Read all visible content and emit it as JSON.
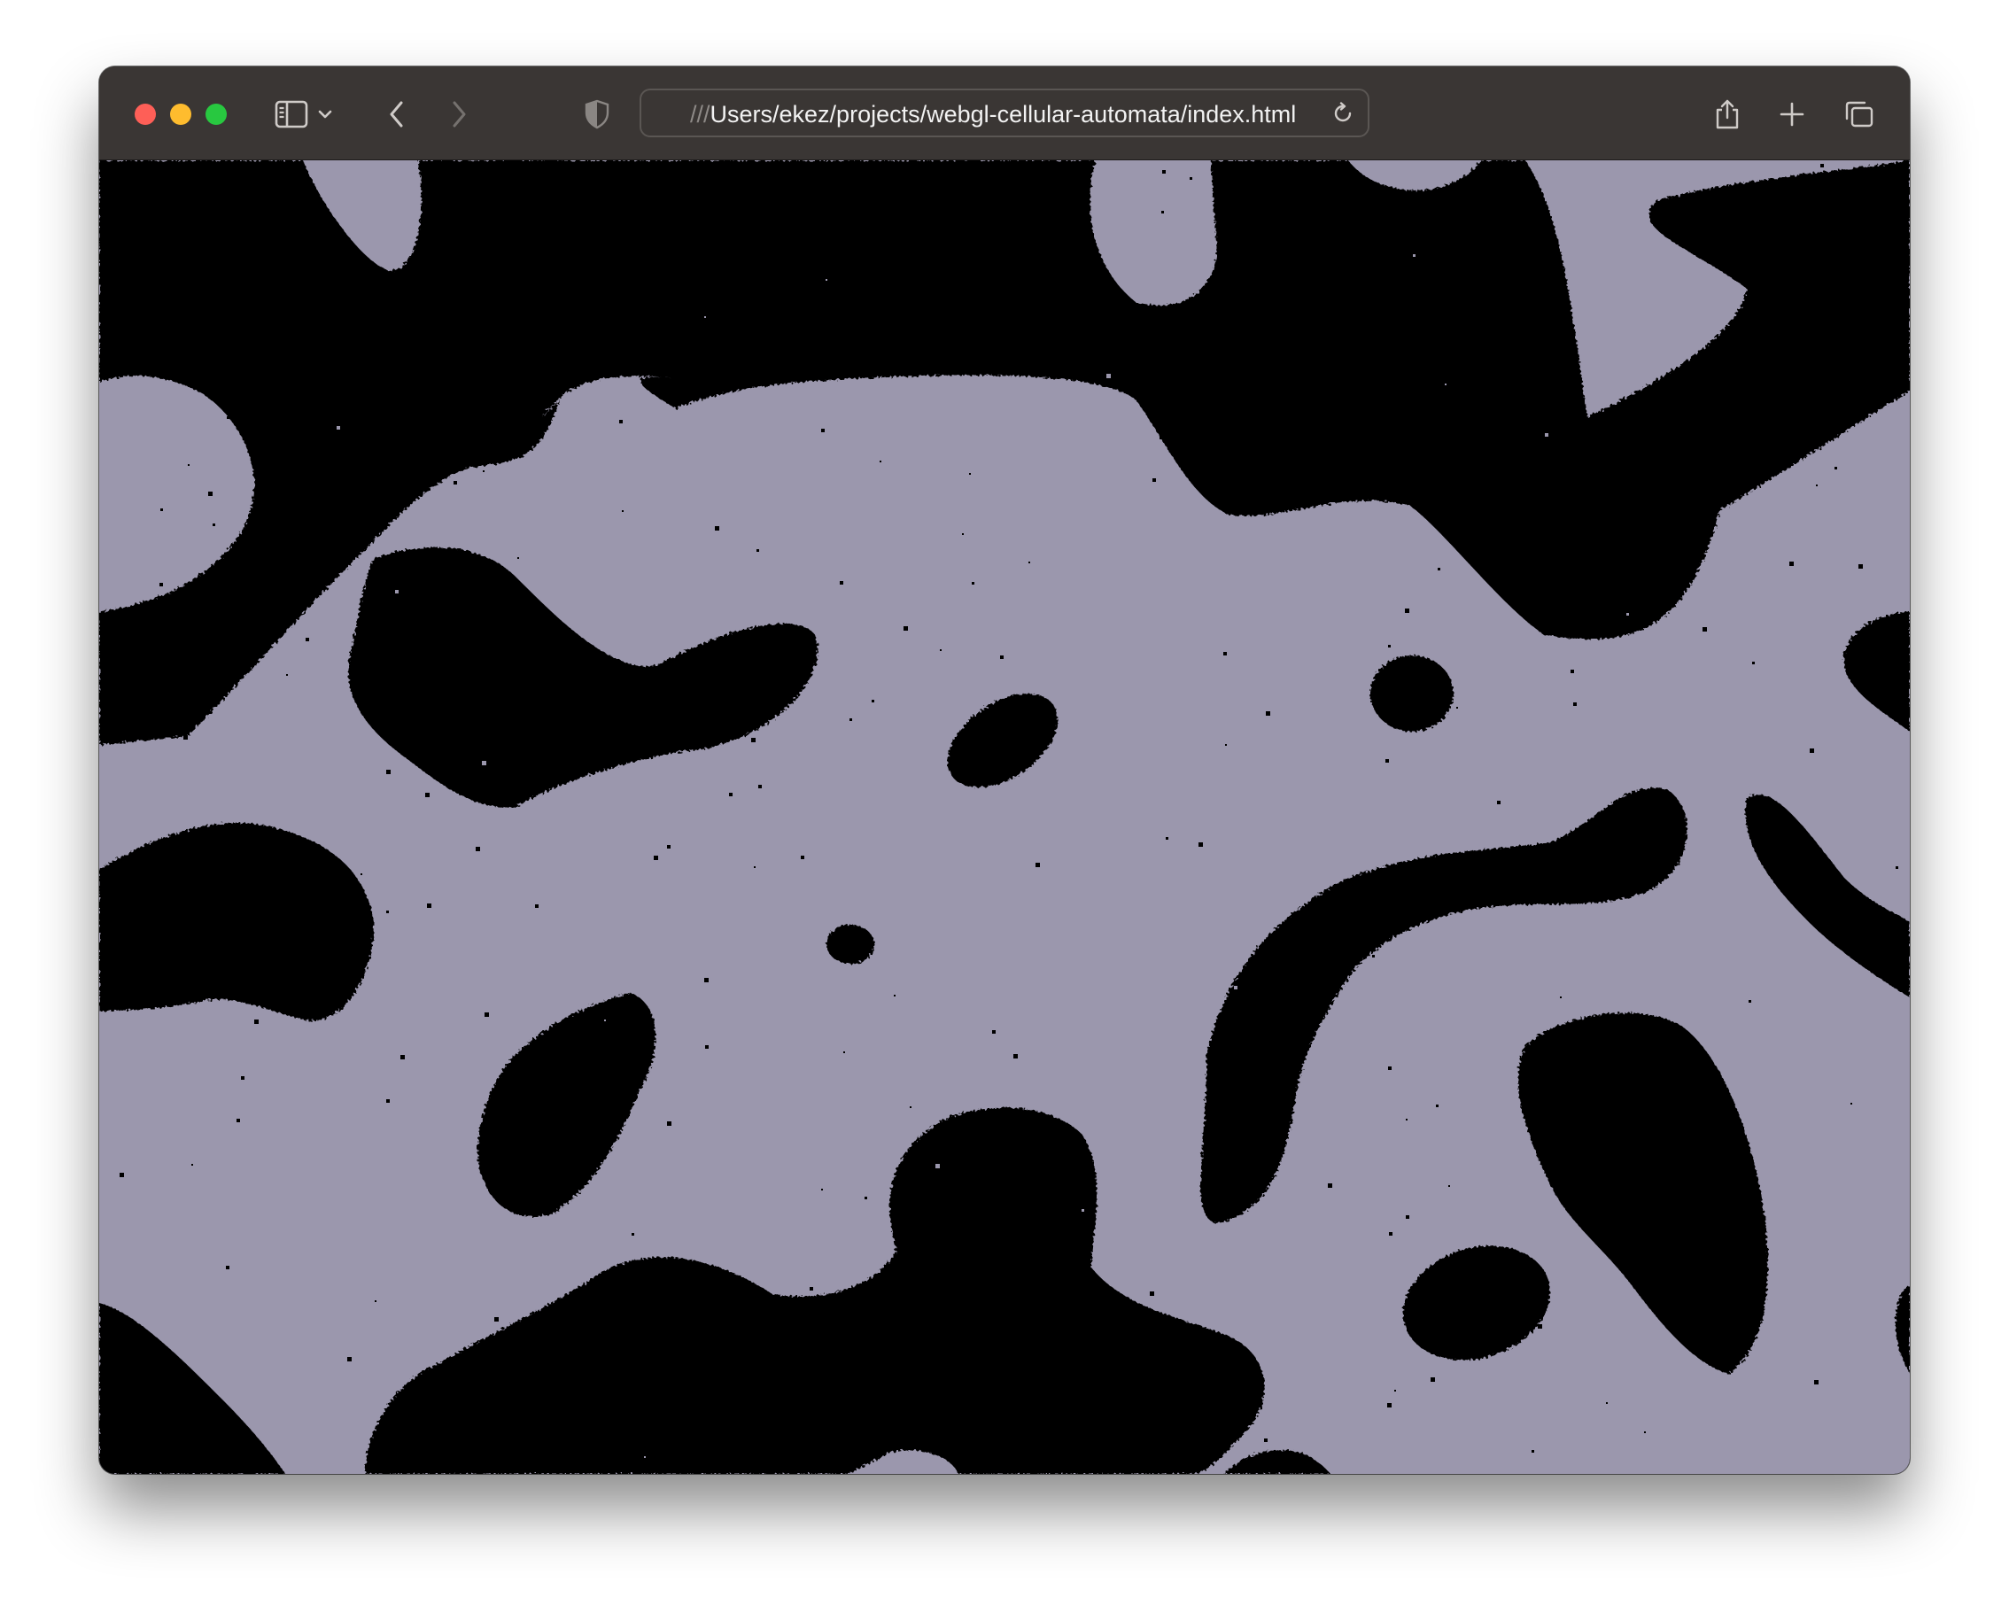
{
  "window": {
    "traffic_lights": {
      "close": "#fe5f57",
      "minimize": "#febc2e",
      "zoom": "#28c840"
    }
  },
  "toolbar": {
    "icons": {
      "sidebar": "sidebar-icon",
      "sidebar_menu": "chevron-down-icon",
      "back": "chevron-left-icon",
      "forward": "chevron-right-icon",
      "privacy": "shield-icon",
      "reload": "reload-icon",
      "share": "share-icon",
      "new_tab": "plus-icon",
      "tab_overview": "tabs-icon"
    }
  },
  "address_bar": {
    "url_prefix": "///",
    "url_path": "Users/ekez/projects/webgl-cellular-automata/index.html"
  },
  "canvas": {
    "colors": {
      "live_cells": "#9b97ad",
      "dead_cells": "#000000"
    }
  }
}
